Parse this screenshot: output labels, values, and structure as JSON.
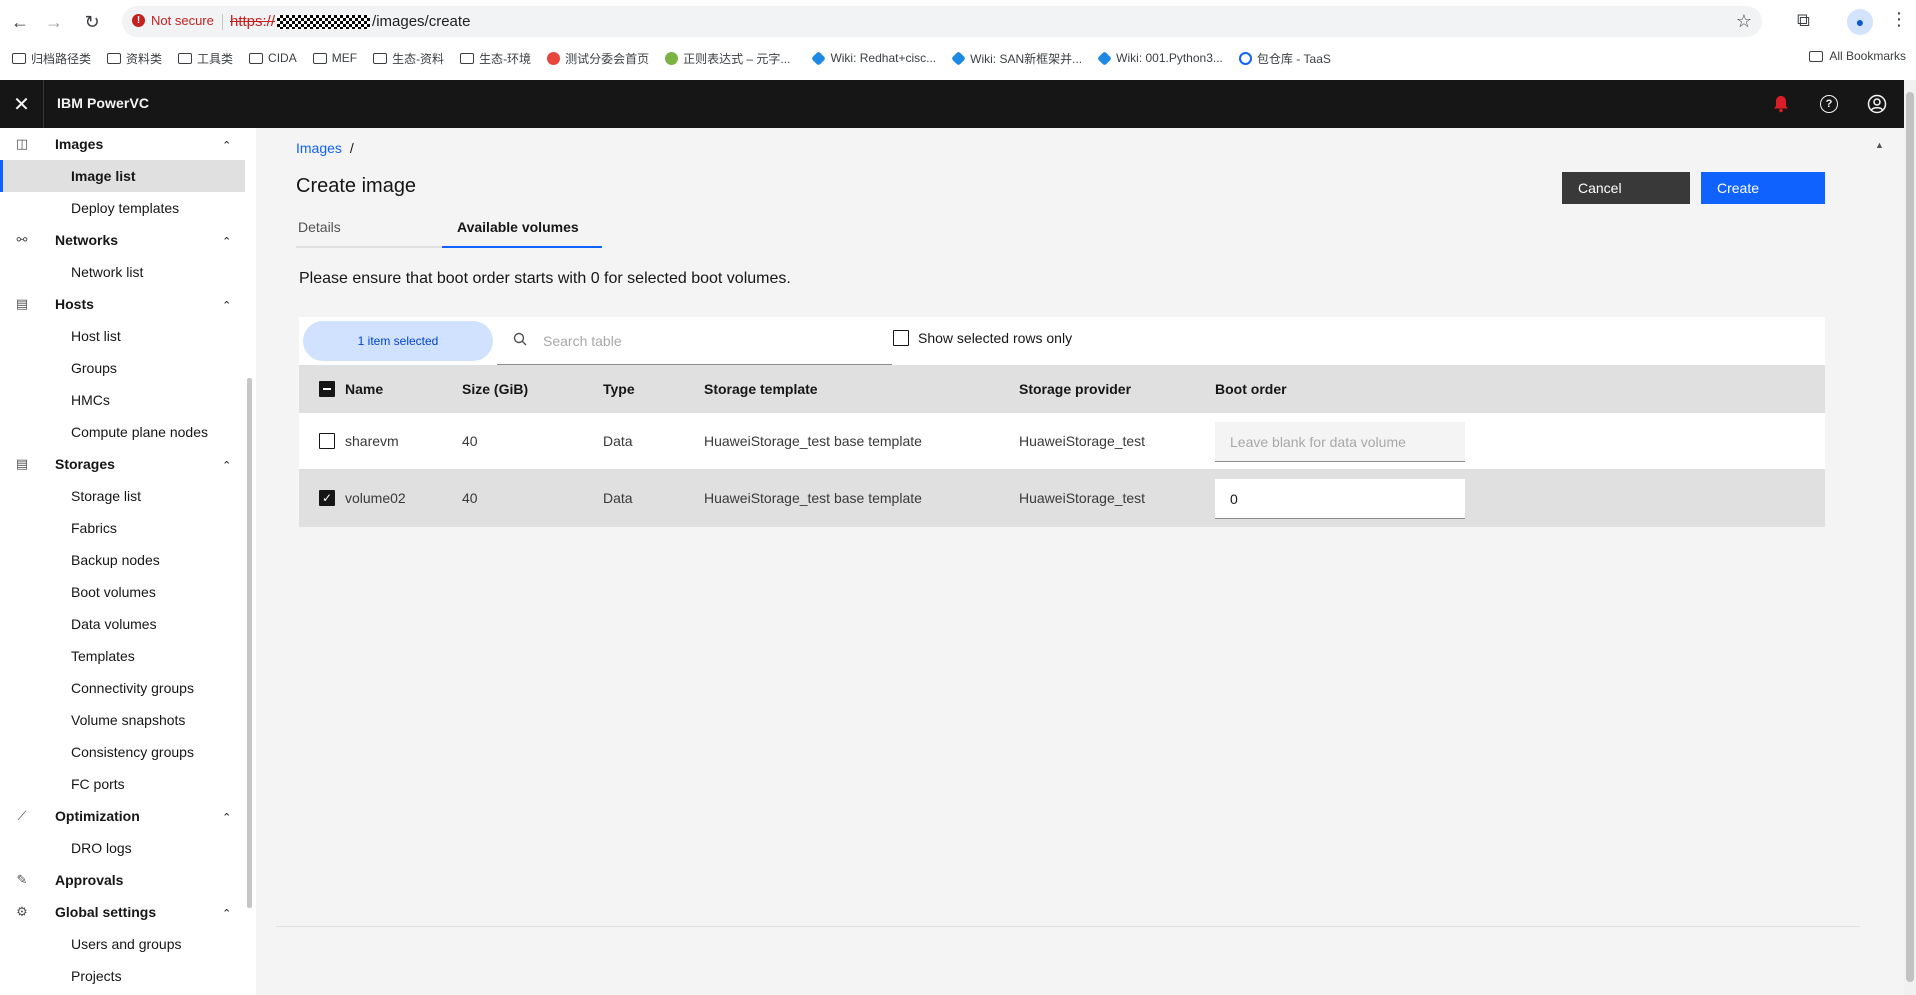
{
  "browser": {
    "not_secure": "Not secure",
    "url_scheme": "https://",
    "url_path": "/images/create",
    "bookmarks": [
      {
        "label": "归档路径类",
        "type": "folder"
      },
      {
        "label": "资料类",
        "type": "folder"
      },
      {
        "label": "工具类",
        "type": "folder"
      },
      {
        "label": "CIDA",
        "type": "folder"
      },
      {
        "label": "MEF",
        "type": "folder"
      },
      {
        "label": "生态-资料",
        "type": "folder"
      },
      {
        "label": "生态-环境",
        "type": "folder"
      },
      {
        "label": "测试分委会首页",
        "type": "site"
      },
      {
        "label": "正则表达式 – 元字...",
        "type": "site"
      },
      {
        "label": "Wiki: Redhat+cisc...",
        "type": "site"
      },
      {
        "label": "Wiki: SAN新框架并...",
        "type": "site"
      },
      {
        "label": "Wiki: 001.Python3...",
        "type": "site"
      },
      {
        "label": "包仓库 - TaaS",
        "type": "site"
      }
    ],
    "all_bookmarks": "All Bookmarks"
  },
  "header": {
    "title": "IBM PowerVC"
  },
  "sidebar": {
    "groups": [
      {
        "label": "Images",
        "icon": "camera-icon",
        "items": [
          "Image list",
          "Deploy templates"
        ]
      },
      {
        "label": "Networks",
        "icon": "network-icon",
        "items": [
          "Network list"
        ]
      },
      {
        "label": "Hosts",
        "icon": "server-icon",
        "items": [
          "Host list",
          "Groups",
          "HMCs",
          "Compute plane nodes"
        ]
      },
      {
        "label": "Storages",
        "icon": "storage-icon",
        "items": [
          "Storage list",
          "Fabrics",
          "Backup nodes",
          "Boot volumes",
          "Data volumes",
          "Templates",
          "Connectivity groups",
          "Volume snapshots",
          "Consistency groups",
          "FC ports"
        ]
      },
      {
        "label": "Optimization",
        "icon": "chart-icon",
        "items": [
          "DRO logs"
        ]
      },
      {
        "label": "Approvals",
        "icon": "edit-icon",
        "items": []
      },
      {
        "label": "Global settings",
        "icon": "gear-icon",
        "items": [
          "Users and groups",
          "Projects"
        ]
      }
    ],
    "active_item": "Image list"
  },
  "main": {
    "breadcrumb": {
      "link": "Images",
      "separator": "/"
    },
    "title": "Create image",
    "cancel_label": "Cancel",
    "create_label": "Create",
    "tabs": [
      {
        "label": "Details",
        "active": false
      },
      {
        "label": "Available volumes",
        "active": true
      }
    ],
    "notice": "Please ensure that boot order starts with 0 for selected boot volumes.",
    "toolbar": {
      "selected_text": "1 item selected",
      "search_placeholder": "Search table",
      "show_selected_label": "Show selected rows only"
    },
    "table": {
      "columns": [
        "Name",
        "Size (GiB)",
        "Type",
        "Storage template",
        "Storage provider",
        "Boot order"
      ],
      "rows": [
        {
          "name": "sharevm",
          "size": "40",
          "type": "Data",
          "template": "HuaweiStorage_test base template",
          "provider": "HuaweiStorage_test",
          "boot_order": "",
          "boot_placeholder": "Leave blank for data volume",
          "selected": false
        },
        {
          "name": "volume02",
          "size": "40",
          "type": "Data",
          "template": "HuaweiStorage_test base template",
          "provider": "HuaweiStorage_test",
          "boot_order": "0",
          "boot_placeholder": "",
          "selected": true
        }
      ]
    }
  },
  "colors": {
    "primary": "#0f62fe",
    "header_bg": "#161616",
    "alert": "#da1e28"
  }
}
